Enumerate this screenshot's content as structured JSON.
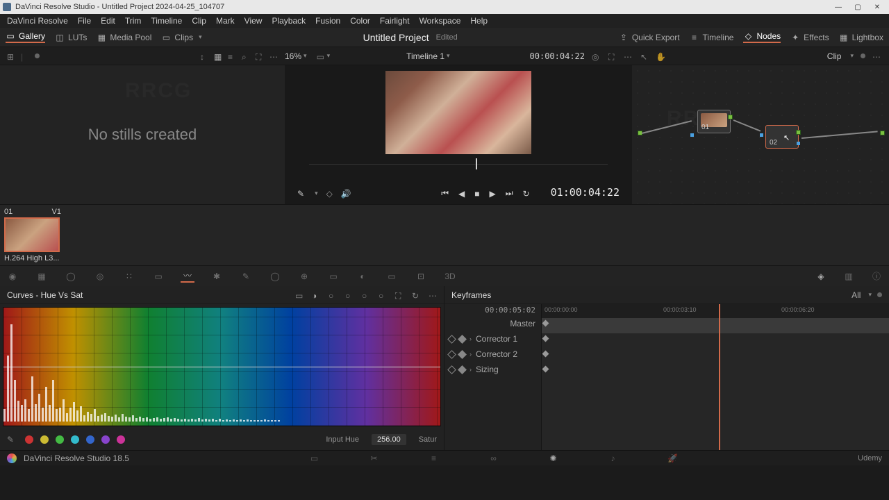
{
  "titlebar": {
    "title": "DaVinci Resolve Studio - Untitled Project 2024-04-25_104707"
  },
  "menu": [
    "DaVinci Resolve",
    "File",
    "Edit",
    "Trim",
    "Timeline",
    "Clip",
    "Mark",
    "View",
    "Playback",
    "Fusion",
    "Color",
    "Fairlight",
    "Workspace",
    "Help"
  ],
  "toolbar": {
    "left": [
      {
        "icon": "gallery",
        "label": "Gallery",
        "active": true
      },
      {
        "icon": "luts",
        "label": "LUTs"
      },
      {
        "icon": "mediapool",
        "label": "Media Pool"
      },
      {
        "icon": "clips",
        "label": "Clips",
        "dropdown": true
      }
    ],
    "center": {
      "title": "Untitled Project",
      "edited": "Edited"
    },
    "right": [
      {
        "icon": "export",
        "label": "Quick Export"
      },
      {
        "icon": "timeline",
        "label": "Timeline"
      },
      {
        "icon": "nodes",
        "label": "Nodes",
        "active": true
      },
      {
        "icon": "effects",
        "label": "Effects"
      },
      {
        "icon": "lightbox",
        "label": "Lightbox"
      }
    ]
  },
  "viewerbar": {
    "zoom": "16%",
    "timeline_name": "Timeline 1",
    "timecode": "00:00:04:22",
    "clip_scope": "Clip"
  },
  "gallery": {
    "empty_text": "No stills created"
  },
  "viewer": {
    "tc": "01:00:04:22"
  },
  "clip": {
    "num": "01",
    "track": "V1",
    "name": "H.264 High L3..."
  },
  "curves": {
    "title": "Curves - Hue Vs Sat",
    "spectrum_peaks": [
      18,
      95,
      140,
      60,
      30,
      24,
      32,
      18,
      65,
      25,
      40,
      20,
      50,
      24,
      60,
      18,
      20,
      32,
      12,
      20,
      28,
      16,
      22,
      9,
      14,
      11,
      18,
      8,
      10,
      12,
      8,
      7,
      10,
      6,
      11,
      7,
      6,
      9,
      5,
      7,
      5,
      6,
      4,
      5,
      6,
      4,
      5,
      6,
      4,
      5,
      4,
      3,
      4,
      3,
      4,
      3,
      5,
      3,
      4,
      3,
      4,
      2,
      4,
      2,
      3,
      2,
      3,
      2,
      3,
      2,
      3,
      2,
      2,
      2,
      2,
      3,
      2,
      2,
      2,
      2
    ],
    "swatches": [
      "#cc3333",
      "#ccbb33",
      "#44bb44",
      "#33bbcc",
      "#3366cc",
      "#8844cc",
      "#cc3399"
    ],
    "input_hue_label": "Input Hue",
    "input_hue_value": "256.00",
    "saturation_label": "Satur"
  },
  "keyframes": {
    "title": "Keyframes",
    "dropdown": "All",
    "tc": "00:00:05:02",
    "ruler": [
      "00:00:00:00",
      "00:00:03:10",
      "00:00:06:20"
    ],
    "tracks": [
      "Master",
      "Corrector 1",
      "Corrector 2",
      "Sizing"
    ]
  },
  "nodes": {
    "n1": "01",
    "n2": "02"
  },
  "footer": {
    "app": "DaVinci Resolve Studio 18.5",
    "brand": "Udemy"
  },
  "watermark": "RRCG"
}
